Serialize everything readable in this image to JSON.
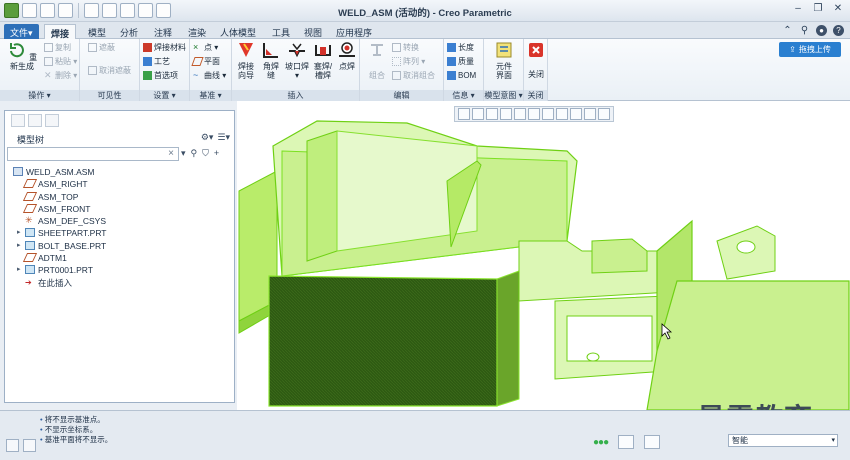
{
  "window": {
    "title": "WELD_ASM (活动的) - Creo Parametric"
  },
  "tabs": [
    {
      "label": "文件▾",
      "type": "file"
    },
    {
      "label": "焊接",
      "type": "active"
    },
    {
      "label": "模型"
    },
    {
      "label": "分析"
    },
    {
      "label": "注释"
    },
    {
      "label": "渲染"
    },
    {
      "label": "人体模型"
    },
    {
      "label": "工具"
    },
    {
      "label": "视图"
    },
    {
      "label": "应用程序"
    }
  ],
  "upload_button": "拖拽上传",
  "ribbon": {
    "groups": {
      "operations": "操作 ▾",
      "visibility": "可见性",
      "settings": "设置 ▾",
      "datum": "基准 ▾",
      "insert": "插入",
      "edit": "编辑",
      "info": "信息 ▾",
      "model_intent": "模型意图 ▾",
      "close": "关闭"
    },
    "regenerate": "重新生成",
    "copy": "复制",
    "paste": "粘贴 ▾",
    "delete": "删除 ▾",
    "hide": "遮蔽",
    "unhide": "取消遮蔽",
    "weld_material": "焊接材料",
    "process": "工艺",
    "preferences": "首选项",
    "point": "点 ▾",
    "plane": "平面",
    "curve": "曲线 ▾",
    "weld_wizard": [
      "焊接",
      "向导"
    ],
    "fillet": [
      "角焊",
      "缝"
    ],
    "groove": [
      "坡口焊",
      "▾"
    ],
    "plug": [
      "塞焊/",
      "槽焊"
    ],
    "spot": "点焊",
    "group": "组合",
    "convert": "转换",
    "pattern": "阵列 ▾",
    "ungroup": "取消组合",
    "length": "长度",
    "mass": "质量",
    "bom": "BOM",
    "notebook": [
      "元件",
      "界面"
    ],
    "close_btn": "关闭"
  },
  "model_tree": {
    "title": "模型树",
    "search_placeholder": "",
    "items": [
      {
        "label": "WELD_ASM.ASM",
        "icon": "assembly-icon",
        "indent": 0,
        "expand": ""
      },
      {
        "label": "ASM_RIGHT",
        "icon": "datum-plane-icon",
        "indent": 1,
        "expand": ""
      },
      {
        "label": "ASM_TOP",
        "icon": "datum-plane-icon",
        "indent": 1,
        "expand": ""
      },
      {
        "label": "ASM_FRONT",
        "icon": "datum-plane-icon",
        "indent": 1,
        "expand": ""
      },
      {
        "label": "ASM_DEF_CSYS",
        "icon": "csys-icon",
        "indent": 1,
        "expand": ""
      },
      {
        "label": "SHEETPART.PRT",
        "icon": "part-icon",
        "indent": 1,
        "expand": "▸"
      },
      {
        "label": "BOLT_BASE.PRT",
        "icon": "part-icon",
        "indent": 1,
        "expand": "▸"
      },
      {
        "label": "ADTM1",
        "icon": "datum-plane-icon",
        "indent": 1,
        "expand": ""
      },
      {
        "label": "PRT0001.PRT",
        "icon": "part-icon",
        "indent": 1,
        "expand": "▸"
      },
      {
        "label": "在此插入",
        "icon": "insert-here-icon",
        "indent": 1,
        "expand": ""
      }
    ]
  },
  "status": {
    "messages": [
      "将不显示基准点。",
      "不显示坐标系。",
      "基准平面将不显示。"
    ],
    "filter": "智能"
  },
  "watermark": "最需教育",
  "colors": {
    "model_green": "#7be021",
    "model_dark": "#2f5a10",
    "accent": "#2d6fb8"
  }
}
